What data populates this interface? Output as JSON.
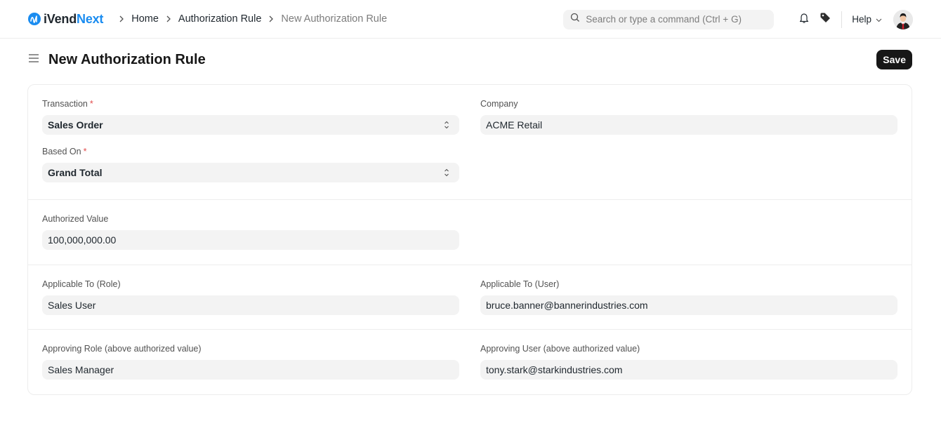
{
  "navbar": {
    "brand_prefix": "iVend",
    "brand_accent": "Next",
    "brand_color": "#1a8cf0",
    "breadcrumbs": [
      {
        "label": "Home"
      },
      {
        "label": "Authorization Rule"
      },
      {
        "label": "New Authorization Rule"
      }
    ],
    "search_placeholder": "Search or type a command (Ctrl + G)",
    "help_label": "Help",
    "icons": [
      "search-icon",
      "bell-icon",
      "tag-icon",
      "chevron-down-icon",
      "avatar"
    ]
  },
  "page": {
    "title": "New Authorization Rule",
    "save_label": "Save"
  },
  "form": {
    "transaction": {
      "label": "Transaction",
      "required": "*",
      "value": "Sales Order"
    },
    "based_on": {
      "label": "Based On",
      "required": "*",
      "value": "Grand Total"
    },
    "company": {
      "label": "Company",
      "value": "ACME Retail"
    },
    "authorized_value": {
      "label": "Authorized Value",
      "value": "100,000,000.00"
    },
    "applicable_to_role": {
      "label": "Applicable To (Role)",
      "value": "Sales User"
    },
    "applicable_to_user": {
      "label": "Applicable To (User)",
      "value": "bruce.banner@bannerindustries.com"
    },
    "approving_role": {
      "label": "Approving Role (above authorized value)",
      "value": "Sales Manager"
    },
    "approving_user": {
      "label": "Approving User (above authorized value)",
      "value": "tony.stark@starkindustries.com"
    }
  }
}
